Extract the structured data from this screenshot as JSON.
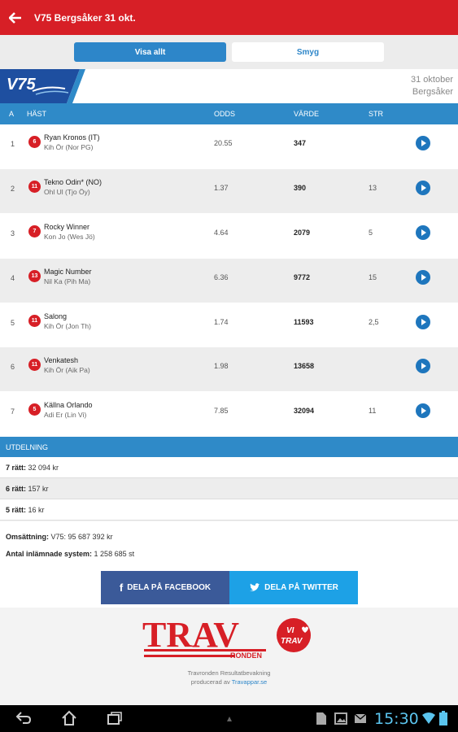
{
  "appbar": {
    "title": "V75 Bergsåker 31 okt."
  },
  "segments": {
    "active": "Visa allt",
    "inactive": "Smyg"
  },
  "header": {
    "logo_text": "V75",
    "date": "31 oktober",
    "track": "Bergsåker"
  },
  "table": {
    "columns": {
      "a": "A",
      "hast": "HÄST",
      "odds": "ODDS",
      "varde": "VÄRDE",
      "str": "STR"
    },
    "rows": [
      {
        "a": "1",
        "num": "6",
        "horse": "Ryan Kronos (IT)",
        "driver": "Kih Ör (Nor PG)",
        "odds": "20.55",
        "varde": "347",
        "str": ""
      },
      {
        "a": "2",
        "num": "11",
        "horse": "Tekno Odin* (NO)",
        "driver": "Ohl Ul (Tjo Öy)",
        "odds": "1.37",
        "varde": "390",
        "str": "13"
      },
      {
        "a": "3",
        "num": "7",
        "horse": "Rocky Winner",
        "driver": "Kon Jo (Wes Jö)",
        "odds": "4.64",
        "varde": "2079",
        "str": "5"
      },
      {
        "a": "4",
        "num": "13",
        "horse": "Magic Number",
        "driver": "Nil Ka (Pih Ma)",
        "odds": "6.36",
        "varde": "9772",
        "str": "15"
      },
      {
        "a": "5",
        "num": "11",
        "horse": "Salong",
        "driver": "Kih Ör (Jon Th)",
        "odds": "1.74",
        "varde": "11593",
        "str": "2,5"
      },
      {
        "a": "6",
        "num": "11",
        "horse": "Venkatesh",
        "driver": "Kih Ör (Aik Pa)",
        "odds": "1.98",
        "varde": "13658",
        "str": ""
      },
      {
        "a": "7",
        "num": "5",
        "horse": "Källna Orlando",
        "driver": "Adi Er (Lin Vi)",
        "odds": "7.85",
        "varde": "32094",
        "str": "11"
      }
    ]
  },
  "payout": {
    "header": "UTDELNING",
    "r7_label": "7 rätt:",
    "r7_value": "32 094 kr",
    "r6_label": "6 rätt:",
    "r6_value": "157 kr",
    "r5_label": "5 rätt:",
    "r5_value": "16 kr"
  },
  "summary": {
    "turnover_label": "Omsättning:",
    "turnover_value": "V75: 95 687 392 kr",
    "systems_label": "Antal inlämnade system:",
    "systems_value": "1 258 685 st"
  },
  "share": {
    "facebook": "DELA PÅ FACEBOOK",
    "twitter": "DELA PÅ TWITTER"
  },
  "footer": {
    "logo_main": "TRAV",
    "logo_sub": "RONDEN",
    "badge_top": "VI",
    "badge_bottom": "TRAV",
    "credit_line1": "Travronden Resultatbevakning",
    "credit_prefix": "producerad av",
    "credit_link": "Travappar.se"
  },
  "statusbar": {
    "time": "15:30"
  },
  "colors": {
    "brand_red": "#d71f26",
    "accent_blue": "#2f8ac8"
  }
}
